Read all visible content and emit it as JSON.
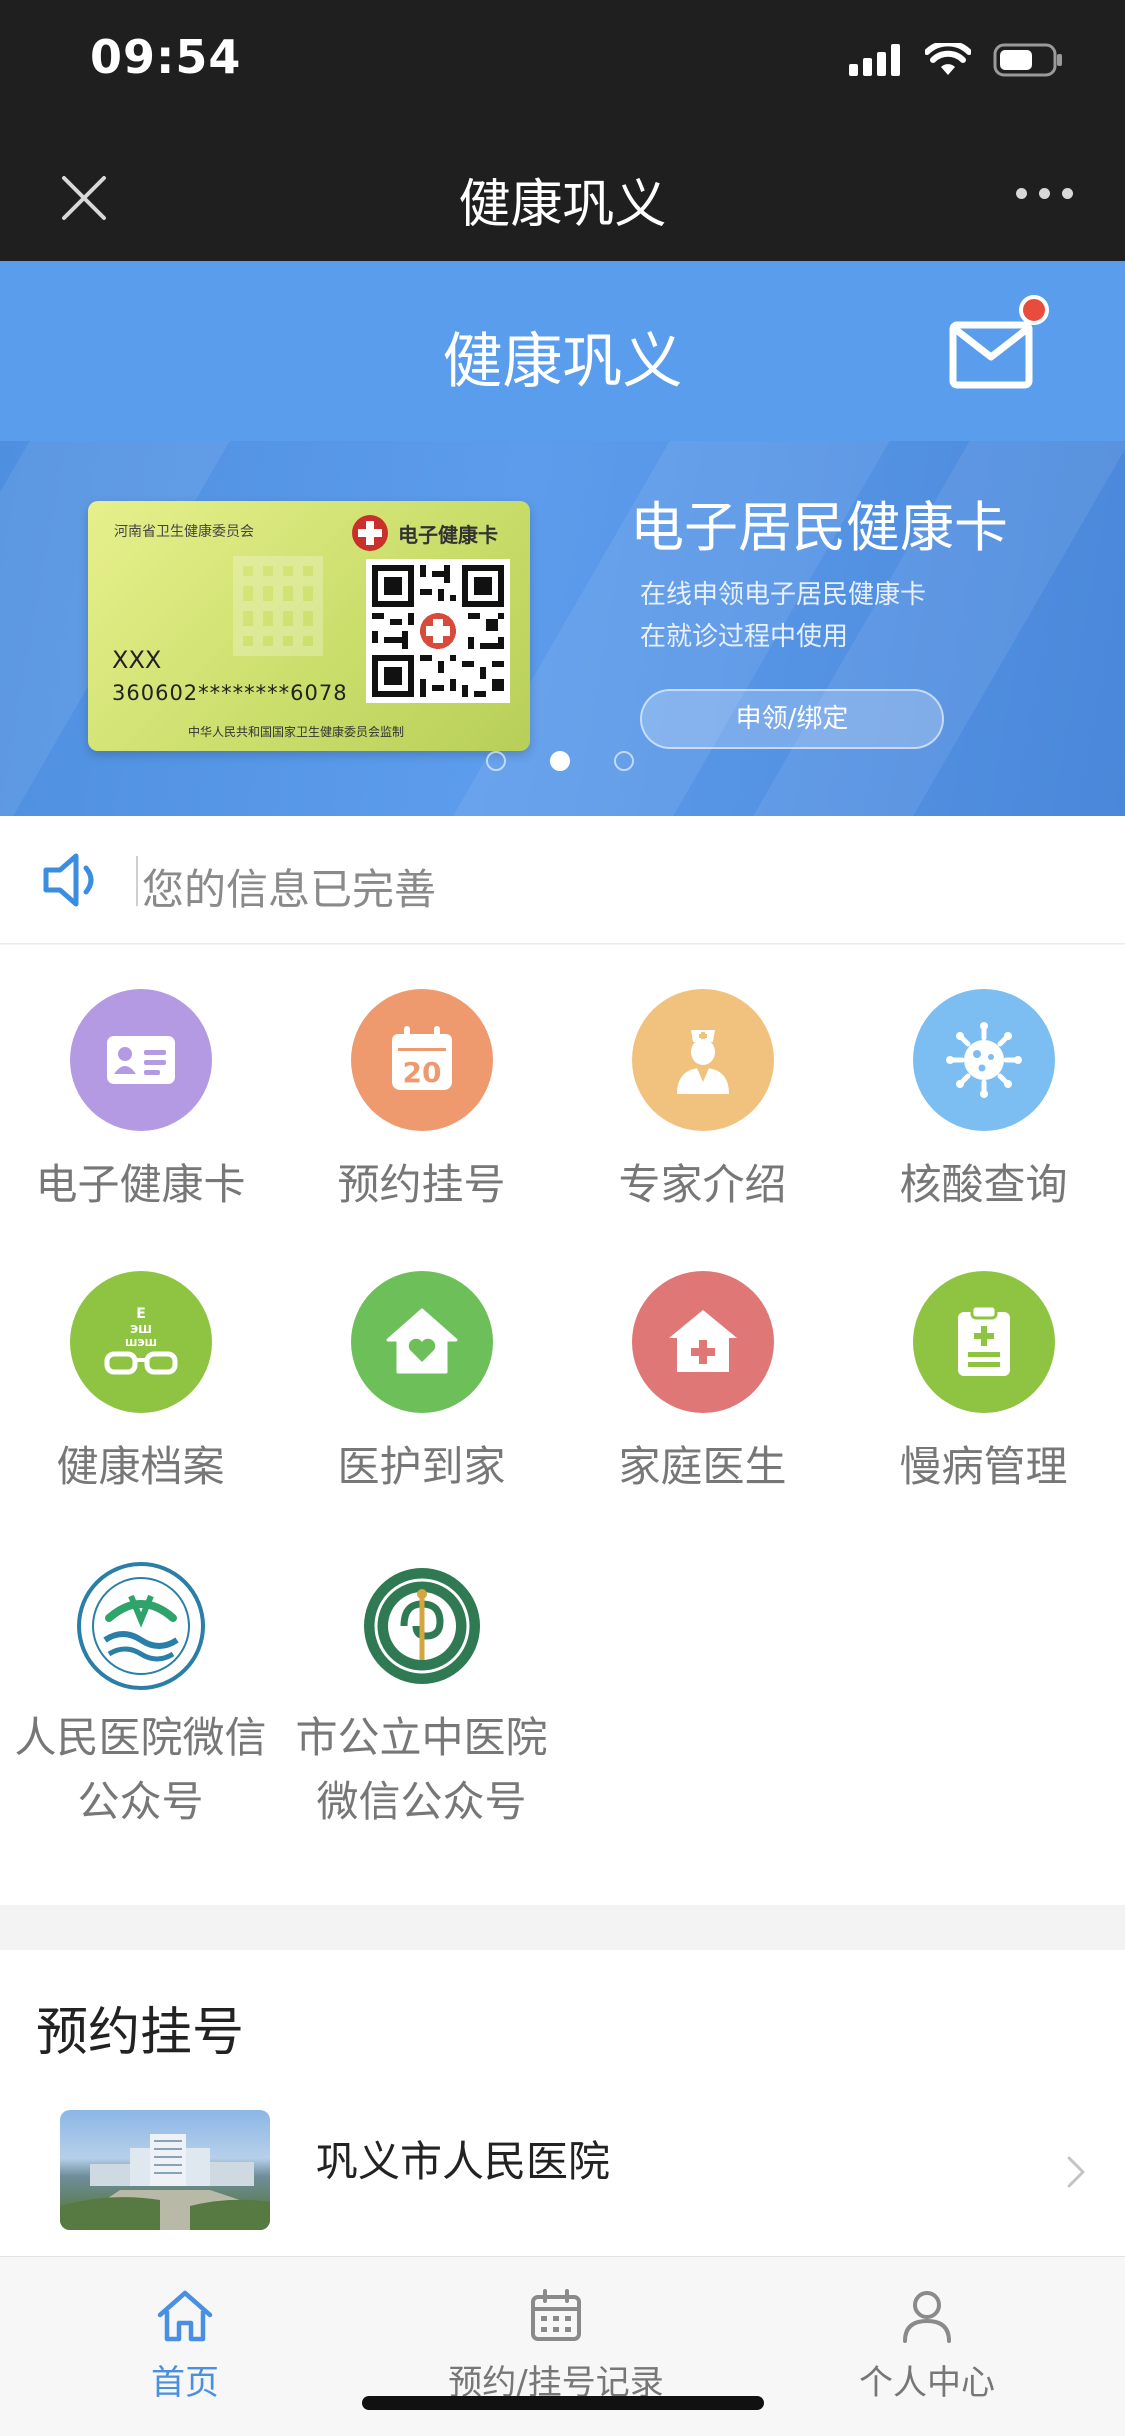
{
  "status_bar": {
    "time": "09:54"
  },
  "nav_bar": {
    "title": "健康巩义"
  },
  "header": {
    "title": "健康巩义",
    "has_unread_mail": true
  },
  "banner": {
    "card": {
      "issuer": "河南省卫生健康委员会",
      "card_title": "电子健康卡",
      "name": "XXX",
      "id_masked": "360602********6078",
      "footer": "中华人民共和国国家卫生健康委员会监制"
    },
    "title": "电子居民健康卡",
    "line1": "在线申领电子居民健康卡",
    "line2": "在就诊过程中使用",
    "button": "申领/绑定",
    "active_slide": 2,
    "slide_count": 3
  },
  "notice": {
    "text": "您的信息已完善"
  },
  "services": [
    {
      "label": "电子健康卡",
      "icon": "id-card-icon",
      "color": "#b49ae3"
    },
    {
      "label": "预约挂号",
      "icon": "calendar-icon",
      "color": "#ef9a6e"
    },
    {
      "label": "专家介绍",
      "icon": "doctor-icon",
      "color": "#f0c27e"
    },
    {
      "label": "核酸查询",
      "icon": "virus-icon",
      "color": "#7cbdf2"
    },
    {
      "label": "健康档案",
      "icon": "eye-chart-icon",
      "color": "#8fc443"
    },
    {
      "label": "医护到家",
      "icon": "home-heart-icon",
      "color": "#6dbf5a"
    },
    {
      "label": "家庭医生",
      "icon": "medical-house-icon",
      "color": "#e07777"
    },
    {
      "label": "慢病管理",
      "icon": "clipboard-icon",
      "color": "#8fc443"
    }
  ],
  "official_accounts": [
    {
      "line1": "人民医院微信",
      "line2": "公众号"
    },
    {
      "line1": "市公立中医院",
      "line2": "微信公众号"
    }
  ],
  "appointment": {
    "section_title": "预约挂号",
    "hospital": "巩义市人民医院"
  },
  "tab_bar": {
    "tabs": [
      {
        "label": "首页",
        "active": true
      },
      {
        "label": "预约/挂号记录",
        "active": false
      },
      {
        "label": "个人中心",
        "active": false
      }
    ],
    "active_color": "#4a90e2"
  }
}
